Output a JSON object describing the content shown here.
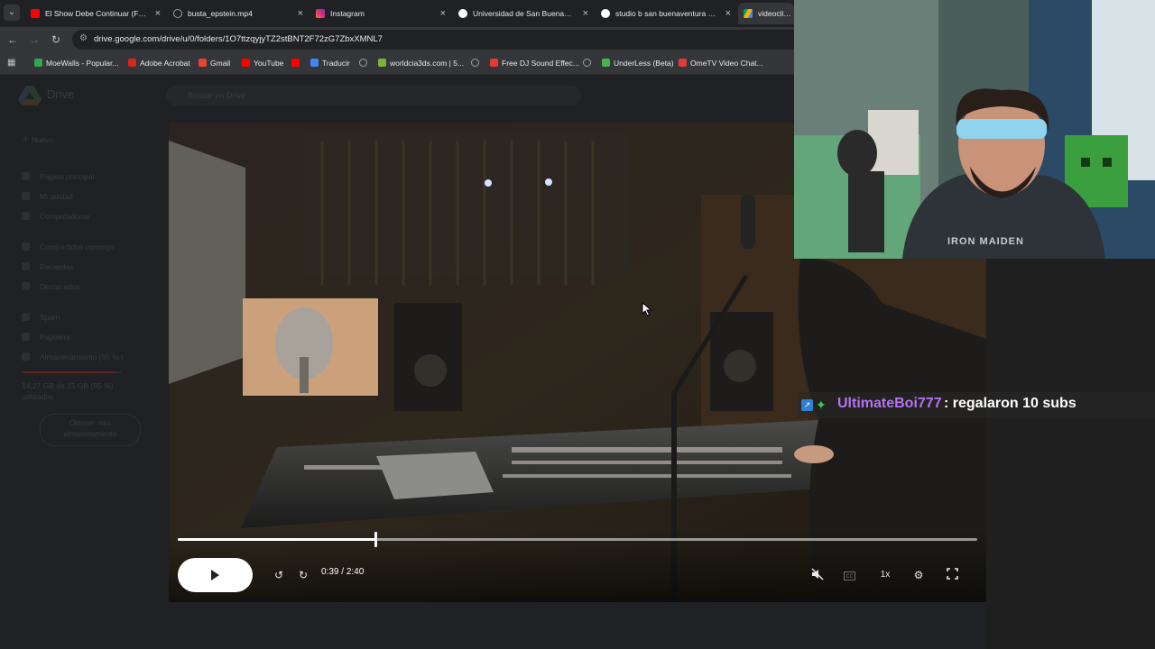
{
  "browser": {
    "tabs": [
      {
        "title": "El Show Debe Continuar (Full A",
        "favicon_color": "#ff0000"
      },
      {
        "title": "busta_epstein.mp4",
        "favicon_color": "#9aa0a6"
      },
      {
        "title": "Instagram",
        "favicon_color": "#e1306c"
      },
      {
        "title": "Universidad de San Buenavent",
        "favicon_color": "#4285f4"
      },
      {
        "title": "studio b san buenaventura me",
        "favicon_color": "#4285f4"
      },
      {
        "title": "videoclips -",
        "favicon_color": "#0f9d58"
      }
    ],
    "url": "drive.google.com/drive/u/0/folders/1O7ttzqyjyTZ2stBNT2F72zG7ZbxXMNL7",
    "bookmarks": [
      {
        "label": "MoeWalls - Popular...",
        "color": "#2fa84f"
      },
      {
        "label": "Adobe Acrobat",
        "color": "#d7261e"
      },
      {
        "label": "Gmail",
        "color": "#ea4335"
      },
      {
        "label": "YouTube",
        "color": "#ff0000"
      },
      {
        "label": "Traducir",
        "color": "#4285f4"
      },
      {
        "label": "",
        "color": "#9aa0a6"
      },
      {
        "label": "worldcia3ds.com | 5...",
        "color": "#7bb33a"
      },
      {
        "label": "",
        "color": "#9aa0a6"
      },
      {
        "label": "Free DJ Sound Effec...",
        "color": "#e53935"
      },
      {
        "label": "",
        "color": "#9aa0a6"
      },
      {
        "label": "UnderLess (Beta)",
        "color": "#4caf50"
      },
      {
        "label": "OmeTV Video Chat...",
        "color": "#e53935"
      }
    ]
  },
  "drive": {
    "brand": "Drive",
    "search_placeholder": "Buscar en Drive",
    "new_button": "Nuevo",
    "nav": [
      "Página principal",
      "Mi unidad",
      "Computadoras",
      "Compartidos conmigo",
      "Recientes",
      "Destacados",
      "Spam",
      "Papelera",
      "Almacenamiento (95 % l"
    ],
    "storage_text": "14,27 GB de 15 GB (95 %)",
    "storage_sub": "utilizados",
    "more_storage": "Obtener más almacenamiento"
  },
  "player": {
    "current_time": "0:39",
    "separator": "/",
    "duration": "2:40",
    "progress_fraction": 0.2475,
    "speed": "1x"
  },
  "chat": {
    "username": "UltimateBoi777",
    "message": ": regalaron 10 subs"
  },
  "webcam": {
    "shirt_text": "IRON MAIDEN"
  }
}
